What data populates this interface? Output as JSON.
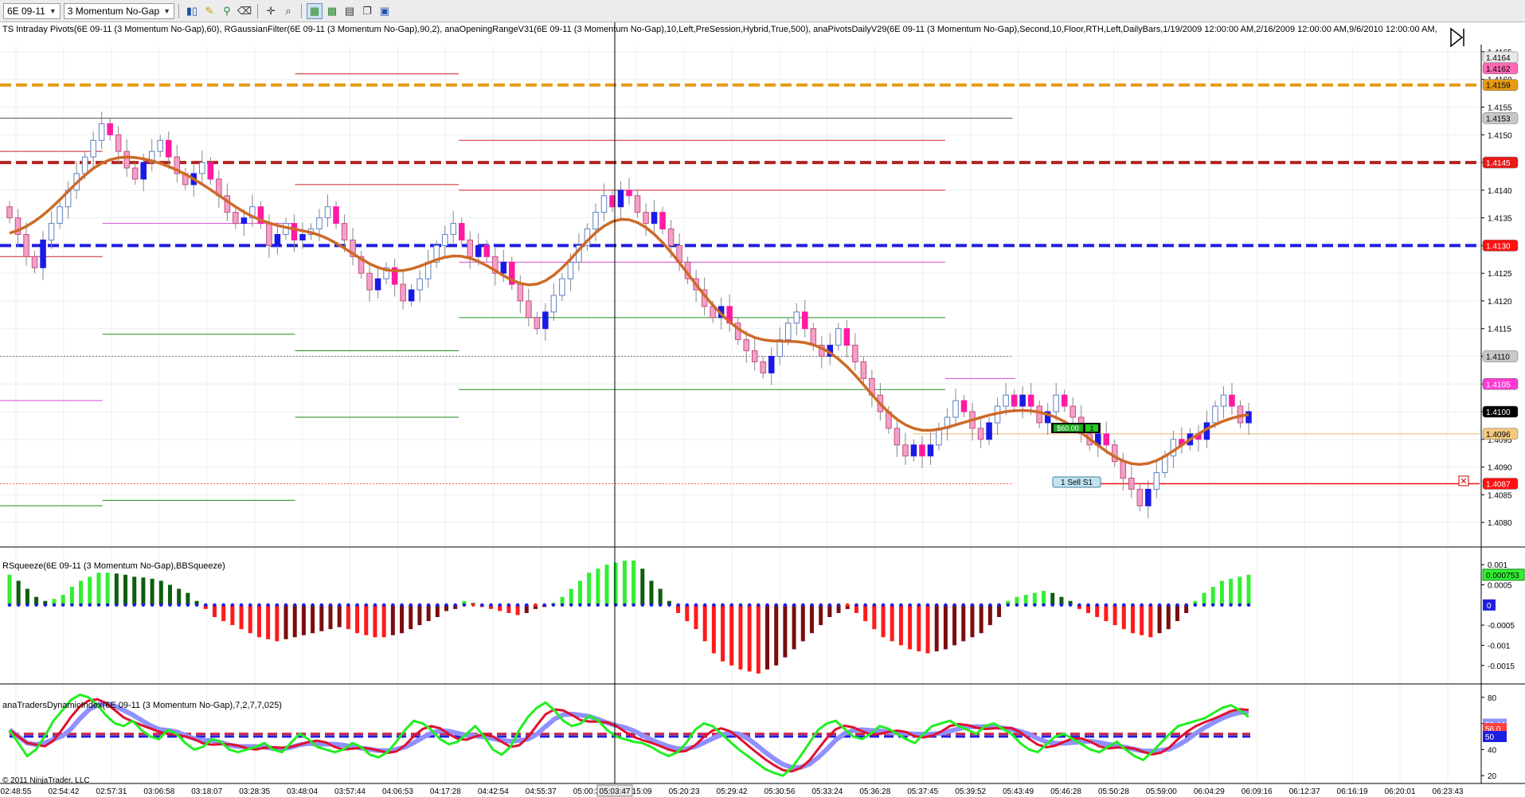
{
  "toolbar": {
    "instrument": "6E 09-11",
    "bar_type": "3 Momentum No-Gap"
  },
  "indicator_labels": {
    "price": "TS Intraday Pivots(6E 09-11 (3 Momentum No-Gap),60),  RGaussianFilter(6E 09-11 (3 Momentum No-Gap),90,2),  anaOpeningRangeV31(6E 09-11 (3 Momentum No-Gap),10,Left,PreSession,Hybrid,True,500), anaPivotsDailyV29(6E 09-11 (3 Momentum No-Gap),Second,10,Floor,RTH,Left,DailyBars,1/19/2009 12:00:00 AM,2/16/2009 12:00:00 AM,9/6/2010 12:00:00 AM,",
    "squeeze": "RSqueeze(6E 09-11 (3 Momentum No-Gap),BBSqueeze)",
    "tdi": "anaTradersDynamicIndex(6E 09-11 (3 Momentum No-Gap),7,2,7,7,025)"
  },
  "copyright": "© 2011 NinjaTrader, LLC",
  "crosshair_time": "05:03:47",
  "chart_data": [
    {
      "type": "candlestick",
      "panel": "price",
      "ylim": [
        1.4076,
        1.4166
      ],
      "y_ticks": [
        "1.4165",
        "1.4160",
        "1.4155",
        "1.4150",
        "1.4145",
        "1.4140",
        "1.4135",
        "1.4130",
        "1.4125",
        "1.4120",
        "1.4115",
        "1.4110",
        "1.4105",
        "1.4100",
        "1.4095",
        "1.4090",
        "1.4085",
        "1.4080"
      ],
      "price_levels": [
        {
          "label": "1.4164",
          "value": 1.4164,
          "color": "#e8e8e8",
          "text_color": "#000000"
        },
        {
          "label": "1.4162",
          "value": 1.4162,
          "color": "#ff69b4",
          "text_color": "#000000"
        },
        {
          "label": "1.4159",
          "value": 1.4159,
          "color": "#e69a12",
          "text_color": "#000000"
        },
        {
          "label": "1.4153",
          "value": 1.4153,
          "color": "#c8c8c8",
          "text_color": "#000000"
        },
        {
          "label": "1.4145",
          "value": 1.4145,
          "color": "#e81a1a",
          "text_color": "#ffffff"
        },
        {
          "label": "1.4130",
          "value": 1.413,
          "color": "#ff1010",
          "text_color": "#ffffff"
        },
        {
          "label": "1.4110",
          "value": 1.411,
          "color": "#c8c8c8",
          "text_color": "#000000"
        },
        {
          "label": "1.4105",
          "value": 1.4105,
          "color": "#ff3ad1",
          "text_color": "#ffffff"
        },
        {
          "label": "1.4100",
          "value": 1.41,
          "color": "#000000",
          "text_color": "#ffffff"
        },
        {
          "label": "1.4096",
          "value": 1.4096,
          "color": "#f2c97e",
          "text_color": "#000000"
        },
        {
          "label": "1.4087",
          "value": 1.4087,
          "color": "#ff1010",
          "text_color": "#ffffff"
        }
      ],
      "order": {
        "label": "1  Sell  S1",
        "price": 1.4087
      },
      "position": {
        "label": "$60.00",
        "qty": "1",
        "price": 1.4096
      },
      "horizontal_lines": [
        {
          "value": 1.4159,
          "color": "#e69a12",
          "style": "dash-thick",
          "x0": 0,
          "x1": 1
        },
        {
          "value": 1.4145,
          "color": "#b22222",
          "style": "dash-thick",
          "x0": 0,
          "x1": 1
        },
        {
          "value": 1.413,
          "color": "#1f1fe0",
          "style": "dash-thick",
          "x0": 0,
          "x1": 1
        },
        {
          "value": 1.4153,
          "color": "#555555",
          "style": "solid",
          "x0": 0.0,
          "x1": 0.81
        },
        {
          "value": 1.411,
          "color": "#777777",
          "style": "dotted",
          "x0": 0.0,
          "x1": 0.81
        },
        {
          "value": 1.4087,
          "color": "#ff6633",
          "style": "dotted",
          "x0": 0.0,
          "x1": 0.81
        },
        {
          "value": 1.4161,
          "color": "#cc2222",
          "style": "solid",
          "x0": 0.236,
          "x1": 0.367
        },
        {
          "value": 1.4149,
          "color": "#cc2222",
          "style": "solid",
          "x0": 0.367,
          "x1": 0.756
        },
        {
          "value": 1.4141,
          "color": "#cc2222",
          "style": "solid",
          "x0": 0.236,
          "x1": 0.367
        },
        {
          "value": 1.414,
          "color": "#cc2222",
          "style": "solid",
          "x0": 0.367,
          "x1": 0.756
        },
        {
          "value": 1.4147,
          "color": "#cc2222",
          "style": "solid",
          "x0": 0.0,
          "x1": 0.082
        },
        {
          "value": 1.4128,
          "color": "#cc2222",
          "style": "solid",
          "x0": 0.0,
          "x1": 0.082
        },
        {
          "value": 1.4134,
          "color": "#d64ad6",
          "style": "solid",
          "x0": 0.082,
          "x1": 0.236
        },
        {
          "value": 1.4127,
          "color": "#d64ad6",
          "style": "solid",
          "x0": 0.367,
          "x1": 0.756
        },
        {
          "value": 1.4106,
          "color": "#d64ad6",
          "style": "solid",
          "x0": 0.756,
          "x1": 0.812
        },
        {
          "value": 1.4102,
          "color": "#d64ad6",
          "style": "solid",
          "x0": 0.0,
          "x1": 0.082
        },
        {
          "value": 1.4114,
          "color": "#228b22",
          "style": "solid",
          "x0": 0.082,
          "x1": 0.236
        },
        {
          "value": 1.4111,
          "color": "#228b22",
          "style": "solid",
          "x0": 0.236,
          "x1": 0.367
        },
        {
          "value": 1.4117,
          "color": "#228b22",
          "style": "solid",
          "x0": 0.367,
          "x1": 0.756
        },
        {
          "value": 1.4104,
          "color": "#228b22",
          "style": "solid",
          "x0": 0.367,
          "x1": 0.756
        },
        {
          "value": 1.4099,
          "color": "#228b22",
          "style": "solid",
          "x0": 0.236,
          "x1": 0.367
        },
        {
          "value": 1.4084,
          "color": "#228b22",
          "style": "solid",
          "x0": 0.082,
          "x1": 0.236
        },
        {
          "value": 1.4083,
          "color": "#228b22",
          "style": "solid",
          "x0": 0.0,
          "x1": 0.082
        },
        {
          "value": 1.4096,
          "color": "#f0b070",
          "style": "solid",
          "x0": 0.73,
          "x1": 1
        }
      ],
      "closes": [
        1.4135,
        1.4132,
        1.4128,
        1.4126,
        1.4131,
        1.4134,
        1.4137,
        1.414,
        1.4143,
        1.4146,
        1.4149,
        1.4152,
        1.415,
        1.4147,
        1.4144,
        1.4142,
        1.4145,
        1.4147,
        1.4149,
        1.4146,
        1.4143,
        1.4141,
        1.4143,
        1.4145,
        1.4142,
        1.4139,
        1.4136,
        1.4134,
        1.4135,
        1.4137,
        1.4134,
        1.413,
        1.4132,
        1.4134,
        1.4131,
        1.4132,
        1.4133,
        1.4135,
        1.4137,
        1.4134,
        1.4131,
        1.4128,
        1.4125,
        1.4122,
        1.4124,
        1.4126,
        1.4123,
        1.412,
        1.4122,
        1.4124,
        1.4127,
        1.413,
        1.4132,
        1.4134,
        1.4131,
        1.4128,
        1.413,
        1.4128,
        1.4125,
        1.4127,
        1.4123,
        1.412,
        1.4117,
        1.4115,
        1.4118,
        1.4121,
        1.4124,
        1.4127,
        1.413,
        1.4133,
        1.4136,
        1.4139,
        1.4137,
        1.414,
        1.4139,
        1.4136,
        1.4134,
        1.4136,
        1.4133,
        1.413,
        1.4127,
        1.4124,
        1.4122,
        1.4119,
        1.4117,
        1.4119,
        1.4116,
        1.4113,
        1.4111,
        1.4109,
        1.4107,
        1.411,
        1.4113,
        1.4116,
        1.4118,
        1.4115,
        1.4112,
        1.411,
        1.4112,
        1.4115,
        1.4112,
        1.4109,
        1.4106,
        1.4103,
        1.41,
        1.4097,
        1.4094,
        1.4092,
        1.4094,
        1.4092,
        1.4094,
        1.4097,
        1.4099,
        1.4102,
        1.41,
        1.4097,
        1.4095,
        1.4098,
        1.4101,
        1.4103,
        1.4101,
        1.4103,
        1.4101,
        1.4098,
        1.41,
        1.4103,
        1.4101,
        1.4099,
        1.4096,
        1.4094,
        1.4096,
        1.4094,
        1.4091,
        1.4088,
        1.4086,
        1.4083,
        1.4086,
        1.4089,
        1.4092,
        1.4095,
        1.4094,
        1.4096,
        1.4095,
        1.4098,
        1.4101,
        1.4103,
        1.4101,
        1.4098,
        1.41
      ]
    },
    {
      "type": "bar",
      "panel": "squeeze",
      "ylim": [
        -0.0019,
        0.0013
      ],
      "y_ticks": [
        "0.001",
        "0.0005",
        "-0.0005",
        "-0.001",
        "-0.0015"
      ],
      "y_tick_values": [
        0.001,
        0.0005,
        -0.0005,
        -0.001,
        -0.0015
      ],
      "last_label": "0.000753",
      "zero_label": "0",
      "values": [
        0.00075,
        0.0006,
        0.0004,
        0.0002,
        0.0001,
        0.00015,
        0.00025,
        0.00045,
        0.0006,
        0.0007,
        0.0008,
        0.0008,
        0.00078,
        0.00075,
        0.0007,
        0.00068,
        0.00065,
        0.0006,
        0.0005,
        0.0004,
        0.0003,
        0.0001,
        -0.0001,
        -0.0003,
        -0.0004,
        -0.0005,
        -0.0006,
        -0.0007,
        -0.0008,
        -0.00085,
        -0.0009,
        -0.00085,
        -0.0008,
        -0.00075,
        -0.0007,
        -0.00065,
        -0.0006,
        -0.00055,
        -0.0006,
        -0.0007,
        -0.00075,
        -0.0008,
        -0.0008,
        -0.00075,
        -0.0007,
        -0.0006,
        -0.0005,
        -0.0004,
        -0.0003,
        -0.00015,
        -0.0001,
        0.0001,
        5e-05,
        -5e-05,
        -0.0001,
        -0.00015,
        -0.0002,
        -0.00025,
        -0.0002,
        -0.0001,
        -5e-05,
        5e-05,
        0.0002,
        0.0004,
        0.0006,
        0.0008,
        0.0009,
        0.001,
        0.00105,
        0.0011,
        0.0011,
        0.0009,
        0.0006,
        0.0004,
        0.0001,
        -0.0002,
        -0.0004,
        -0.0006,
        -0.0009,
        -0.0012,
        -0.0014,
        -0.0015,
        -0.0016,
        -0.00165,
        -0.0017,
        -0.0016,
        -0.0015,
        -0.0013,
        -0.0011,
        -0.0009,
        -0.0007,
        -0.0005,
        -0.0003,
        -0.0002,
        -0.0001,
        -0.0002,
        -0.0004,
        -0.0006,
        -0.0008,
        -0.0009,
        -0.001,
        -0.0011,
        -0.00115,
        -0.0012,
        -0.00115,
        -0.0011,
        -0.001,
        -0.0009,
        -0.0008,
        -0.0007,
        -0.0005,
        -0.0003,
        0.0001,
        0.0002,
        0.00025,
        0.0003,
        0.00035,
        0.0003,
        0.0002,
        0.0001,
        -0.0001,
        -0.0002,
        -0.0003,
        -0.0004,
        -0.0005,
        -0.0006,
        -0.0007,
        -0.00075,
        -0.0008,
        -0.0007,
        -0.0006,
        -0.0004,
        -0.0002,
        0.0001,
        0.0003,
        0.00045,
        0.0006,
        0.00065,
        0.0007,
        0.00075
      ]
    },
    {
      "type": "line",
      "panel": "tdi",
      "ylim": [
        14,
        86
      ],
      "y_ticks": [
        "80",
        "60",
        "40",
        "20"
      ],
      "y_tick_values": [
        80,
        60,
        40,
        20
      ],
      "value_labels": [
        {
          "label": "59.44",
          "value": 59.44,
          "color": "#9090ff"
        },
        {
          "label": "56.0",
          "value": 56.0,
          "color": "#ff4040"
        },
        {
          "label": "50",
          "value": 50,
          "color": "#1f1fe0"
        }
      ],
      "reference_levels": [
        {
          "value": 50,
          "color": "#1f1fe0"
        },
        {
          "value": 52,
          "color": "#cc2244"
        }
      ],
      "fast": [
        55,
        45,
        35,
        40,
        50,
        62,
        70,
        78,
        82,
        80,
        74,
        66,
        60,
        58,
        62,
        55,
        50,
        48,
        55,
        52,
        45,
        40,
        42,
        48,
        46,
        40,
        38,
        40,
        42,
        45,
        40,
        38,
        45,
        52,
        48,
        42,
        40,
        38,
        40,
        45,
        42,
        36,
        34,
        38,
        46,
        55,
        62,
        60,
        55,
        48,
        44,
        46,
        52,
        58,
        50,
        40,
        36,
        42,
        55,
        65,
        72,
        76,
        70,
        62,
        58,
        60,
        66,
        62,
        55,
        50,
        48,
        46,
        45,
        42,
        38,
        35,
        38,
        45,
        55,
        60,
        58,
        52,
        46,
        40,
        35,
        30,
        25,
        22,
        20,
        26,
        35,
        45,
        55,
        60,
        62,
        56,
        50,
        48,
        52,
        58,
        56,
        52,
        48,
        45,
        52,
        58,
        60,
        62,
        58,
        55,
        52,
        58,
        60,
        56,
        52,
        45,
        40,
        38,
        44,
        50,
        52,
        48,
        44,
        40,
        38,
        42,
        46,
        40,
        35,
        32,
        38,
        45,
        52,
        58,
        60,
        62,
        64,
        68,
        72,
        74,
        70,
        65
      ]
    }
  ],
  "x_axis": {
    "labels": [
      "02:48:55",
      "02:54:42",
      "02:57:31",
      "03:06:58",
      "03:18:07",
      "03:28:35",
      "03:48:04",
      "03:57:44",
      "04:06:53",
      "04:17:28",
      "04:42:54",
      "04:55:37",
      "05:00:33",
      "05:15:09",
      "05:20:23",
      "05:29:42",
      "05:30:56",
      "05:33:24",
      "05:36:28",
      "05:37:45",
      "05:39:52",
      "05:43:49",
      "05:46:28",
      "05:50:28",
      "05:59:00",
      "06:04:29",
      "06:09:16",
      "06:12:37",
      "06:16:19",
      "06:20:01",
      "06:23:43"
    ]
  }
}
